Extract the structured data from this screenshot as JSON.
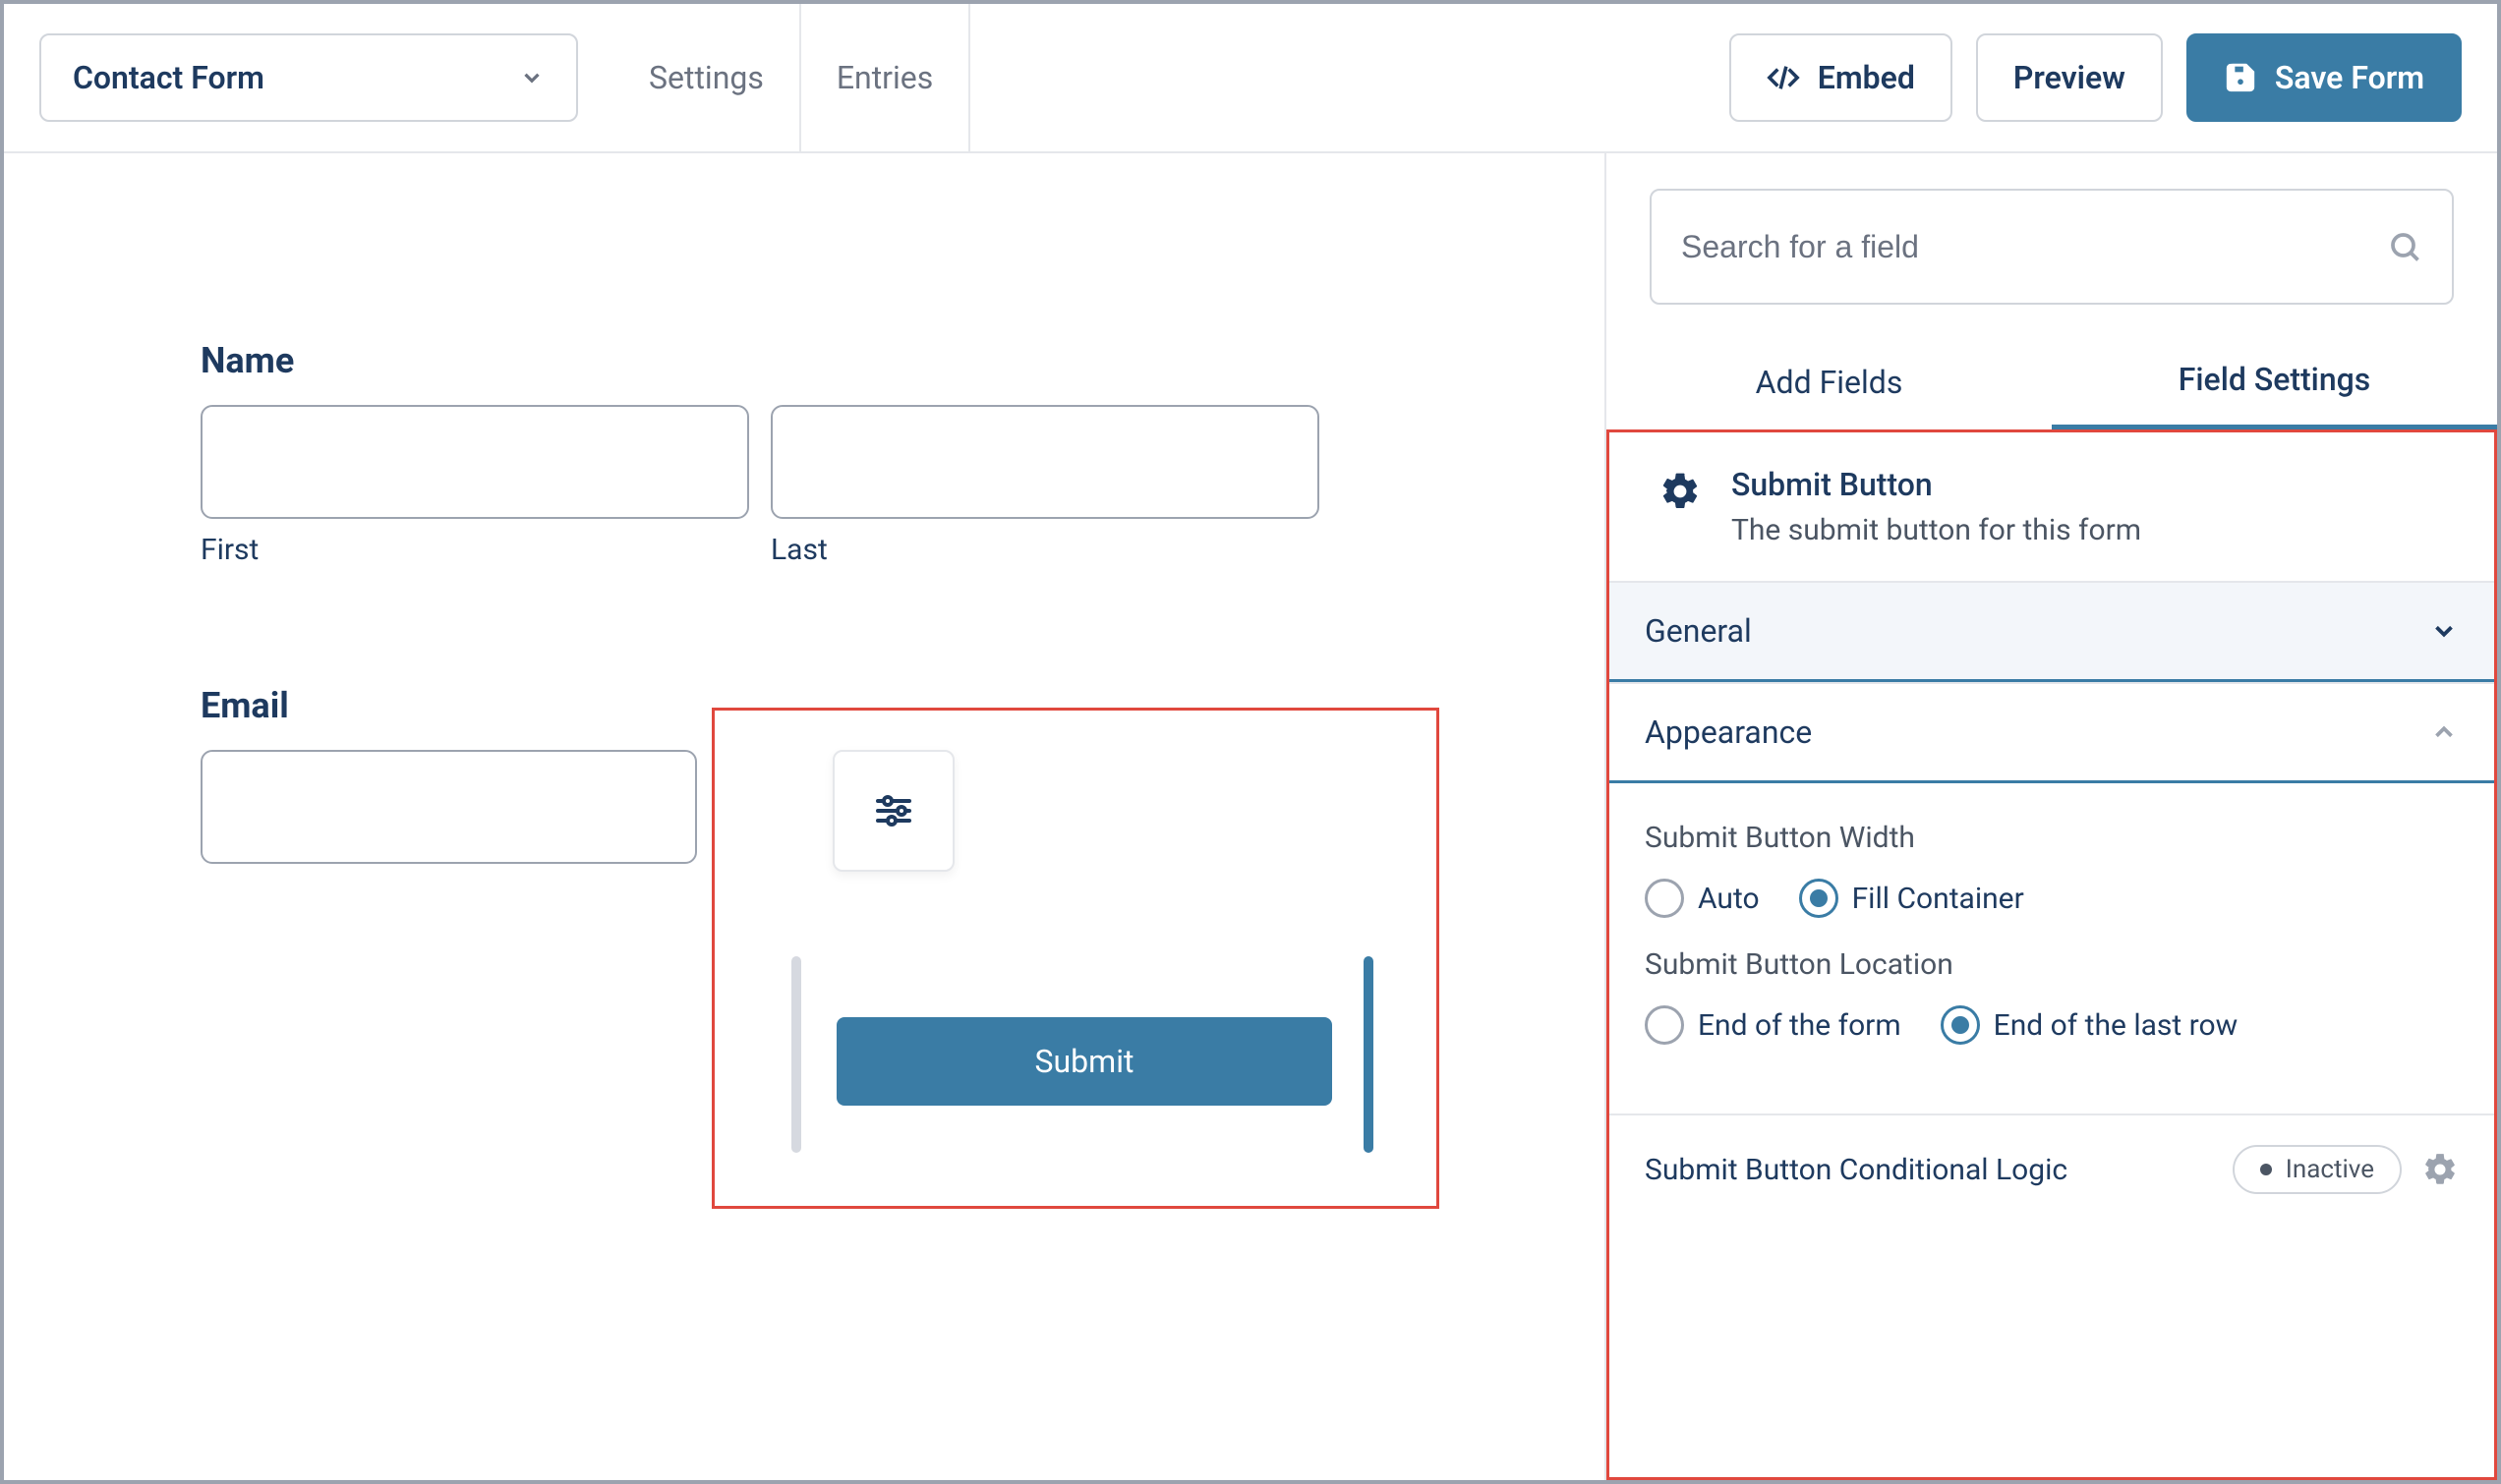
{
  "topbar": {
    "form_select": "Contact Form",
    "tabs": {
      "settings": "Settings",
      "entries": "Entries"
    },
    "embed": "Embed",
    "preview": "Preview",
    "save": "Save Form"
  },
  "canvas": {
    "name_label": "Name",
    "first_label": "First",
    "last_label": "Last",
    "email_label": "Email",
    "submit_label": "Submit"
  },
  "sidebar": {
    "search_placeholder": "Search for a field",
    "tabs": {
      "add": "Add Fields",
      "settings": "Field Settings"
    },
    "header": {
      "title": "Submit Button",
      "desc": "The submit button for this form"
    },
    "sections": {
      "general": "General",
      "appearance": "Appearance"
    },
    "appearance": {
      "width_label": "Submit Button Width",
      "width_options": {
        "auto": "Auto",
        "fill": "Fill Container"
      },
      "width_selected": "fill",
      "location_label": "Submit Button Location",
      "location_options": {
        "end_form": "End of the form",
        "end_row": "End of the last row"
      },
      "location_selected": "end_row"
    },
    "logic": {
      "label": "Submit Button Conditional Logic",
      "status": "Inactive"
    }
  }
}
